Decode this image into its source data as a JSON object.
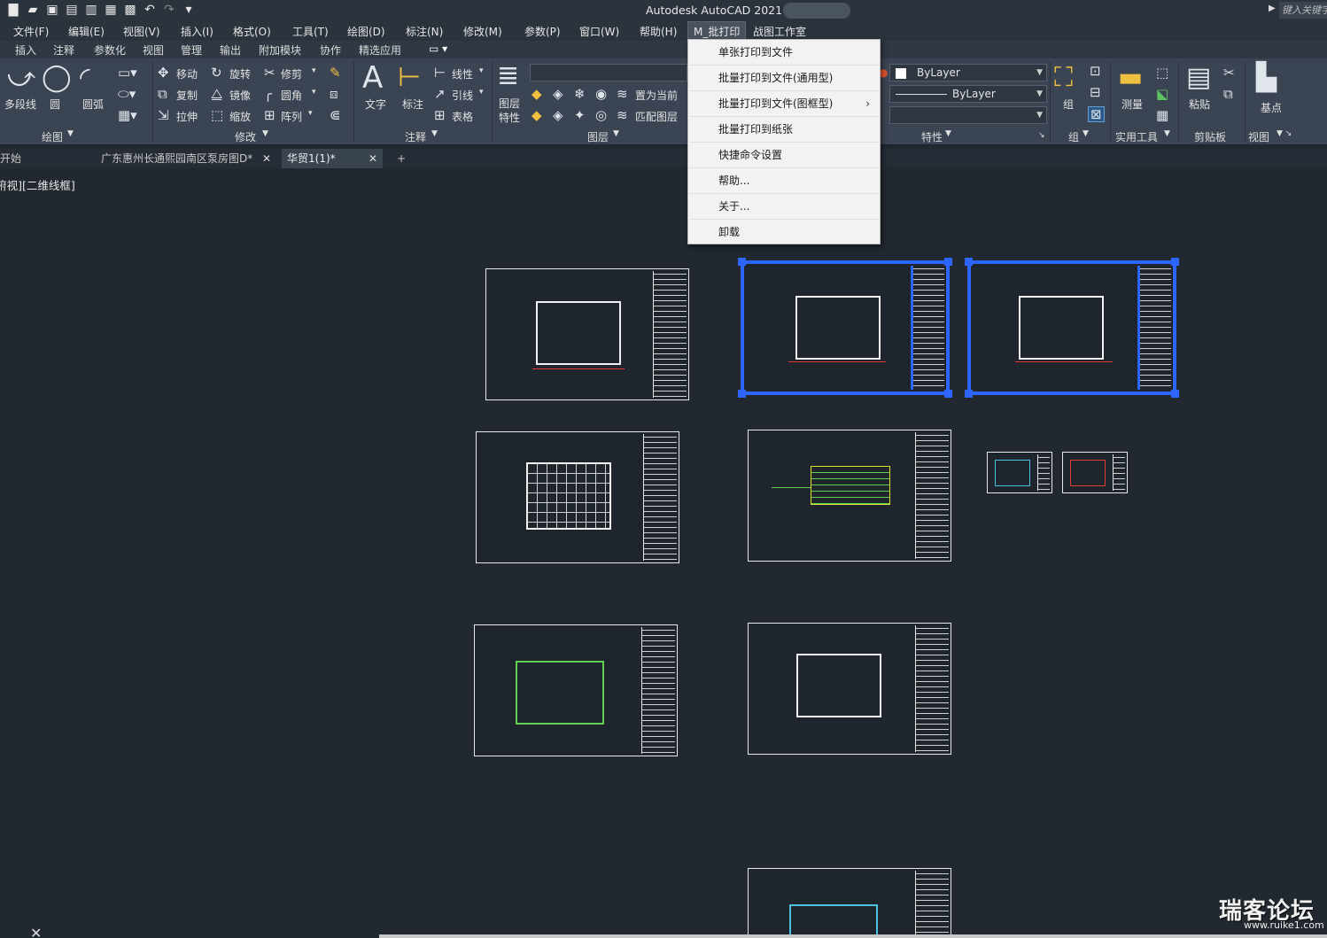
{
  "window": {
    "title": "Autodesk AutoCAD 2021",
    "search_placeholder": "键入关键字"
  },
  "quick_access": [
    "new-icon",
    "open-icon",
    "save-icon",
    "save-as-icon",
    "web-icon",
    "plot-icon",
    "print-icon",
    "undo-icon",
    "redo-icon",
    "customize-icon"
  ],
  "menubar": [
    {
      "label": "文件(F)"
    },
    {
      "label": "编辑(E)"
    },
    {
      "label": "视图(V)"
    },
    {
      "label": "插入(I)"
    },
    {
      "label": "格式(O)"
    },
    {
      "label": "工具(T)"
    },
    {
      "label": "绘图(D)"
    },
    {
      "label": "标注(N)"
    },
    {
      "label": "修改(M)"
    },
    {
      "label": "参数(P)"
    },
    {
      "label": "窗口(W)"
    },
    {
      "label": "帮助(H)"
    },
    {
      "label": "M_批打印"
    },
    {
      "label": "战图工作室"
    }
  ],
  "ribbon_tabs": [
    {
      "label": "插入"
    },
    {
      "label": "注释"
    },
    {
      "label": "参数化"
    },
    {
      "label": "视图"
    },
    {
      "label": "管理"
    },
    {
      "label": "输出"
    },
    {
      "label": "附加模块"
    },
    {
      "label": "协作"
    },
    {
      "label": "精选应用"
    }
  ],
  "ribbon": {
    "draw": {
      "panel": "绘图",
      "polyline": "多段线",
      "circle": "圆",
      "arc": "圆弧"
    },
    "modify": {
      "panel": "修改",
      "move": "移动",
      "rotate": "旋转",
      "trim": "修剪",
      "copy": "复制",
      "mirror": "镜像",
      "fillet": "圆角",
      "stretch": "拉伸",
      "scale": "缩放",
      "array": "阵列"
    },
    "annotation": {
      "panel": "注释",
      "text": "文字",
      "dimension": "标注",
      "linear": "线性",
      "leader": "引线",
      "table": "表格"
    },
    "layers": {
      "panel": "图层",
      "properties": "图层特性",
      "set_current": "置为当前",
      "match": "匹配图层"
    },
    "properties": {
      "panel": "特性",
      "color": "ByLayer",
      "linetype": "ByLayer"
    },
    "groups": {
      "panel": "组",
      "group": "组"
    },
    "utilities": {
      "panel": "实用工具",
      "measure": "测量"
    },
    "clipboard": {
      "panel": "剪贴板",
      "paste": "粘贴"
    },
    "view": {
      "panel": "视图",
      "base": "基点"
    }
  },
  "file_tabs": [
    {
      "label": "开始"
    },
    {
      "label": "广东惠州长通熙园南区泵房图D*"
    },
    {
      "label": "华贸1(1)*"
    }
  ],
  "viewport_label": "[-][俯视][二维线框]",
  "dropdown": [
    {
      "label": "单张打印到文件"
    },
    {
      "label": "批量打印到文件(通用型)"
    },
    {
      "label": "批量打印到文件(图框型)",
      "has_sub": true
    },
    {
      "label": "批量打印到纸张"
    },
    {
      "label": "快捷命令设置"
    },
    {
      "label": "帮助..."
    },
    {
      "label": "关于..."
    },
    {
      "label": "卸载"
    }
  ],
  "watermark": {
    "text": "瑞客论坛",
    "url": "www.ruike1.com"
  },
  "colors": {
    "canvas": "#212830",
    "ribbon": "#3b4453",
    "selection": "#2d66ff",
    "dim": "#e23a3a"
  }
}
